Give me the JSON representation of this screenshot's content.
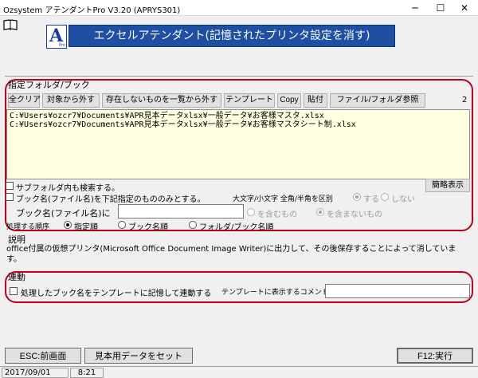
{
  "window": {
    "title": "Ozsystem アテンダントPro V3.20 (APRYS301)",
    "minimize": "─",
    "maximize": "☐",
    "close": "✕"
  },
  "header": {
    "logo_letter": "A",
    "logo_sub": "Pro",
    "title": "エクセルアテンダント(記憶されたプリンタ設定を消す)"
  },
  "folder_section": {
    "label": "指定フォルダ/ブック",
    "count": "2",
    "buttons": {
      "clear_all": "全クリア",
      "remove": "対象から外す",
      "remove_missing": "存在しないものを一覧から外す",
      "template": "テンプレート",
      "copy": "Copy",
      "paste": "貼付",
      "browse": "ファイル/フォルダ参照"
    },
    "files": [
      "C:¥Users¥ozcr7¥Documents¥APR見本データxlsx¥一般データ¥お客様マスタ.xlsx",
      "C:¥Users¥ozcr7¥Documents¥APR見本データxlsx¥一般データ¥お客様マスタシート制.xlsx"
    ]
  },
  "options": {
    "subfolder": "サブフォルダ内も検索する。",
    "simple_view": "簡略表示",
    "name_filter": "ブック名(ファイル名)を下記指定のもののみとする。",
    "case_label": "大文字/小文字 全角/半角を区別",
    "case_yes": "する",
    "case_no": "しない",
    "name_label": "ブック名(ファイル名)に",
    "name_value": "",
    "contains": "を含むもの",
    "not_contains": "を含まないもの",
    "order_label": "処理する順序",
    "order_spec": "指定順",
    "order_book": "ブック名順",
    "order_folder": "フォルダ/ブック名順"
  },
  "description": {
    "label": "説明",
    "text": "office付属の仮想プリンタ(Microsoft Office Document Image Writer)に出力して、その後保存することによって消しています。"
  },
  "link_section": {
    "label": "連動",
    "checkbox": "処理したブック名をテンプレートに記憶して連動する",
    "comment_label": "テンプレートに表示するコメント",
    "comment_value": ""
  },
  "footer": {
    "back": "ESC:前画面",
    "sample": "見本用データをセット",
    "run": "F12:実行"
  },
  "status": {
    "date": "2017/09/01",
    "time": "8:21"
  }
}
